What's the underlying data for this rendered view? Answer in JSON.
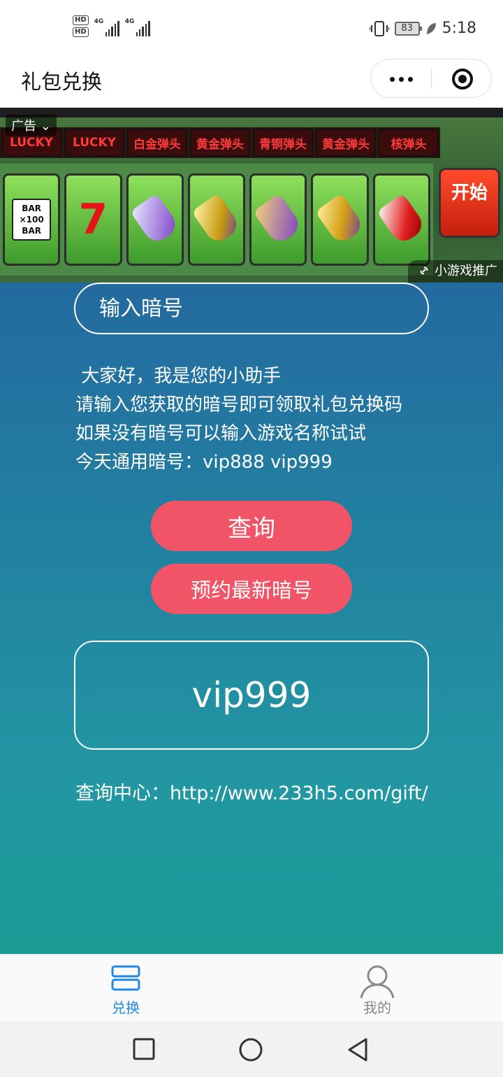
{
  "status_bar": {
    "hd1": "HD",
    "hd2": "HD",
    "net1": "4G",
    "net2": "4G",
    "battery": "83",
    "time": "5:18"
  },
  "title_bar": {
    "title": "礼包兑换",
    "more_icon": "more-dots-icon",
    "close_icon": "target-close-icon"
  },
  "ad": {
    "label": "广告",
    "marquee": [
      "LUCKY",
      "LUCKY",
      "白金弹头",
      "黄金弹头",
      "青铜弹头",
      "黄金弹头",
      "核弹头"
    ],
    "bar_symbol": [
      "BAR",
      "×100",
      "BAR"
    ],
    "seven_symbol": "7",
    "start_button": "开始",
    "promo": "小游戏推广"
  },
  "main": {
    "input_placeholder": "输入暗号",
    "intro_lines": [
      " 大家好，我是您的小助手",
      "请输入您获取的暗号即可领取礼包兑换码",
      "如果没有暗号可以输入游戏名称试试",
      "今天通用暗号：vip888 vip999"
    ],
    "query_button": "查询",
    "reserve_button": "预约最新暗号",
    "result": "vip999",
    "query_center": "查询中心：http://www.233h5.com/gift/"
  },
  "tab_bar": {
    "tabs": [
      {
        "label": "兑换",
        "icon": "exchange-icon",
        "active": true
      },
      {
        "label": "我的",
        "icon": "user-icon",
        "active": false
      }
    ],
    "active_color": "#1e88e5",
    "inactive_color": "#888888"
  },
  "nav_bar": {
    "buttons": [
      "recent-apps-icon",
      "home-icon",
      "back-icon"
    ]
  }
}
